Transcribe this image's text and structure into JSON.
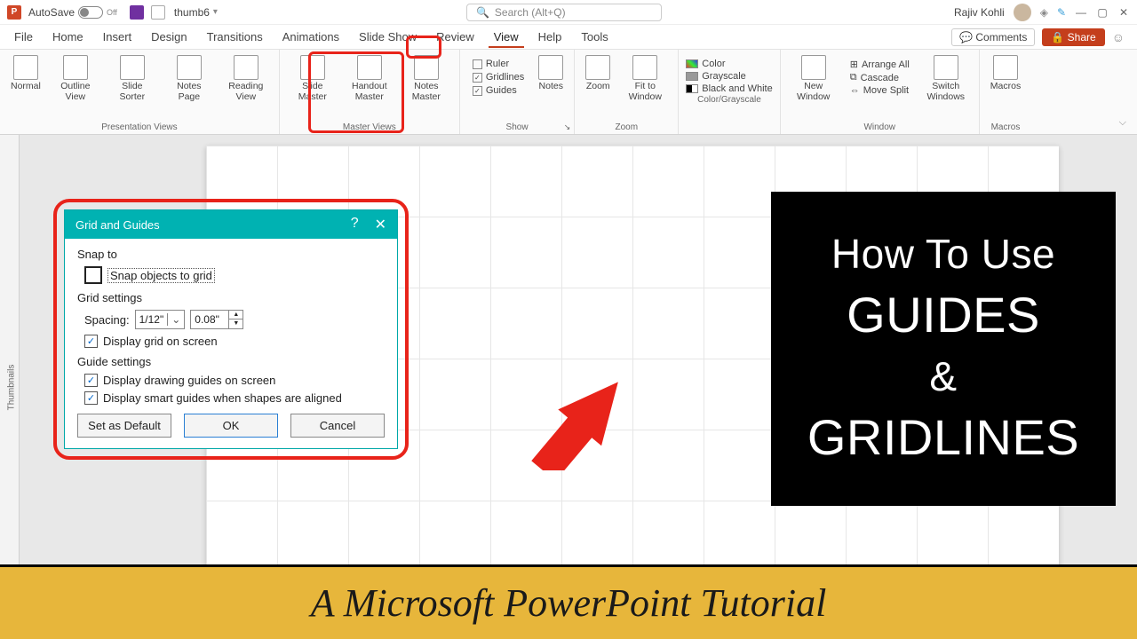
{
  "titlebar": {
    "autosave": "AutoSave",
    "autosave_state": "Off",
    "docname": "thumb6",
    "search_placeholder": "Search (Alt+Q)",
    "username": "Rajiv Kohli"
  },
  "tabs": {
    "items": [
      "File",
      "Home",
      "Insert",
      "Design",
      "Transitions",
      "Animations",
      "Slide Show",
      "Review",
      "View",
      "Help",
      "Tools"
    ],
    "active": "View",
    "comments": "Comments",
    "share": "Share"
  },
  "ribbon": {
    "presentation": {
      "label": "Presentation Views",
      "normal": "Normal",
      "outline": "Outline View",
      "sorter": "Slide Sorter",
      "notes": "Notes Page",
      "reading": "Reading View"
    },
    "master": {
      "label": "Master Views",
      "slide": "Slide Master",
      "handout": "Handout Master",
      "notesm": "Notes Master"
    },
    "show": {
      "label": "Show",
      "ruler": "Ruler",
      "gridlines": "Gridlines",
      "guides": "Guides",
      "notes": "Notes"
    },
    "zoom": {
      "label": "Zoom",
      "zoom": "Zoom",
      "fit": "Fit to Window"
    },
    "color": {
      "label": "Color/Grayscale",
      "color": "Color",
      "gray": "Grayscale",
      "bw": "Black and White"
    },
    "window": {
      "label": "Window",
      "neww": "New Window",
      "arrange": "Arrange All",
      "cascade": "Cascade",
      "split": "Move Split",
      "switch": "Switch Windows"
    },
    "macros": {
      "label": "Macros",
      "macros": "Macros"
    }
  },
  "thumbnails_label": "Thumbnails",
  "dialog": {
    "title": "Grid and Guides",
    "snap_label": "Snap to",
    "snap_to_grid": "Snap objects to grid",
    "grid_settings": "Grid settings",
    "spacing_label": "Spacing:",
    "spacing_val": "1/12\"",
    "spacing_abs": "0.08\"",
    "display_grid": "Display grid on screen",
    "guide_settings": "Guide settings",
    "display_guides": "Display drawing guides on screen",
    "display_smart": "Display smart guides when shapes are aligned",
    "set_default": "Set as Default",
    "ok": "OK",
    "cancel": "Cancel"
  },
  "black_box": {
    "l1": "How To Use",
    "l2": "GUIDES",
    "l3": "&",
    "l4": "GRIDLINES"
  },
  "banner": "A Microsoft PowerPoint Tutorial"
}
